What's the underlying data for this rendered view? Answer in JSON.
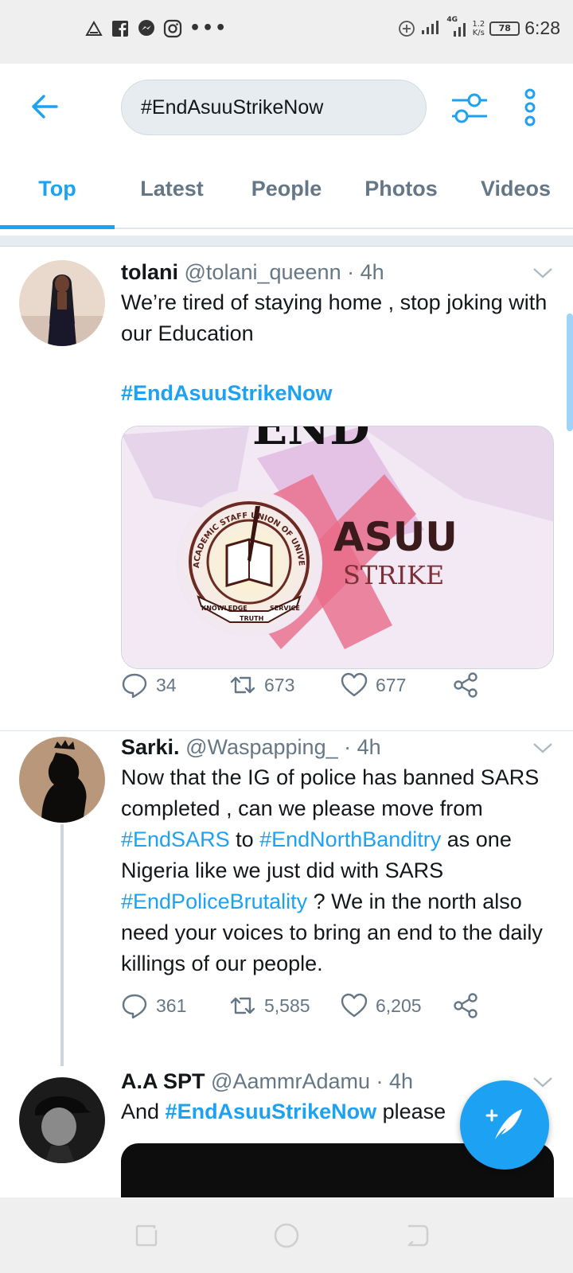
{
  "status_bar": {
    "notification_icons": [
      "alert-triangle-icon",
      "facebook-icon",
      "messenger-icon",
      "instagram-icon"
    ],
    "more_dots": "•••",
    "network_type": "4G",
    "speed_value": "1.2",
    "speed_unit": "K/s",
    "battery": "78",
    "time": "6:28"
  },
  "header": {
    "search_query": "#EndAsuuStrikeNow"
  },
  "tabs": [
    {
      "label": "Top",
      "active": true
    },
    {
      "label": "Latest",
      "active": false
    },
    {
      "label": "People",
      "active": false
    },
    {
      "label": "Photos",
      "active": false
    },
    {
      "label": "Videos",
      "active": false
    }
  ],
  "tweets": [
    {
      "name": "tolani",
      "handle": "@tolani_queenn",
      "time": "· 4h",
      "text": "We’re tired of staying home , stop joking with our Education",
      "hashtag": "#EndAsuuStrikeNow",
      "media": {
        "top_text": "END",
        "logo_ring_text": "ACADEMIC STAFF UNION OF UNIVERSITIES",
        "logo_ribbon": [
          "KNOWLEDGE",
          "TRUTH",
          "SERVICE"
        ],
        "title": "ASUU",
        "subtitle": "STRIKE"
      },
      "replies": "34",
      "retweets": "673",
      "likes": "677"
    },
    {
      "name": "Sarki.",
      "handle": "@Waspapping_",
      "time": "· 4h",
      "text_1": "Now that the IG of police has banned SARS completed , can we please move from ",
      "hashtag_1": "#EndSARS",
      "text_2": " to ",
      "hashtag_2": "#EndNorthBanditry",
      "text_3": " as one Nigeria like we just did with SARS ",
      "hashtag_3": "#EndPoliceBrutality",
      "text_4": " ? We in the north also need your voices to bring an end to the daily killings of our people.",
      "replies": "361",
      "retweets": "5,585",
      "likes": "6,205"
    },
    {
      "name": "A.A SPT",
      "handle": "@AammrAdamu",
      "time": "· 4h",
      "text_1": "And ",
      "hashtag_1": "#EndAsuuStrikeNow",
      "text_2": " please"
    }
  ],
  "colors": {
    "accent": "#1da1f2",
    "secondary_text": "#657786",
    "primary_text": "#14171a"
  }
}
